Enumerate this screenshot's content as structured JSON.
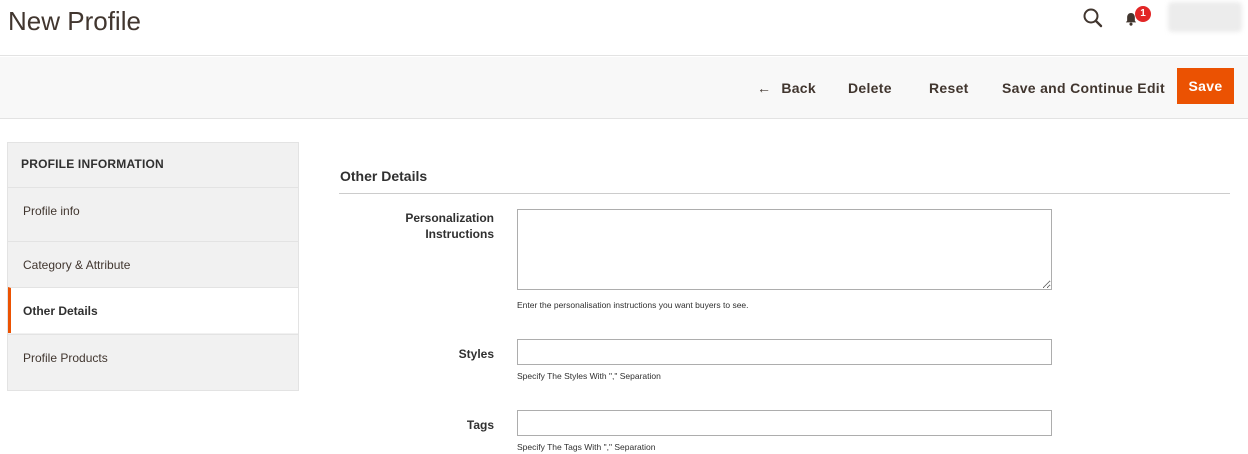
{
  "header": {
    "title": "New Profile",
    "search_icon": "search-icon",
    "notification_icon": "bell-icon",
    "notification_count": "1",
    "badge_color": "#e22626"
  },
  "toolbar": {
    "back_label": "Back",
    "back_icon": "arrow-left-icon",
    "delete_label": "Delete",
    "reset_label": "Reset",
    "save_continue_label": "Save and Continue Edit",
    "save_label": "Save",
    "accent_color": "#eb5202"
  },
  "sidebar": {
    "header": "PROFILE INFORMATION",
    "items": [
      {
        "label": "Profile info",
        "active": false
      },
      {
        "label": "Category & Attribute",
        "active": false
      },
      {
        "label": "Other Details",
        "active": true
      },
      {
        "label": "Profile Products",
        "active": false
      }
    ]
  },
  "main": {
    "section_title": "Other Details",
    "fields": {
      "personalization": {
        "label": "Personalization Instructions",
        "value": "",
        "note": "Enter the personalisation instructions you want buyers to see."
      },
      "styles": {
        "label": "Styles",
        "value": "",
        "note": "Specify The Styles With \",\" Separation"
      },
      "tags": {
        "label": "Tags",
        "value": "",
        "note": "Specify The Tags With \",\" Separation"
      }
    }
  }
}
